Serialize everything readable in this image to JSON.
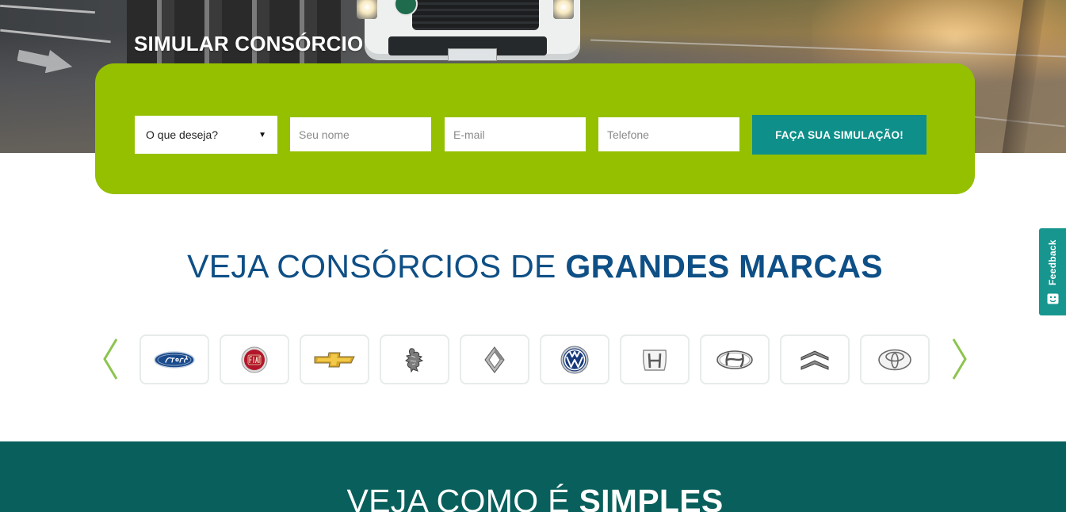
{
  "hero": {
    "title": "SIMULAR CONSÓRCIO"
  },
  "simulation_form": {
    "select": {
      "selected": "O que deseja?"
    },
    "name_field": {
      "placeholder": "Seu nome"
    },
    "email_field": {
      "placeholder": "E-mail"
    },
    "phone_field": {
      "placeholder": "Telefone"
    },
    "submit_label": "FAÇA SUA SIMULAÇÃO!",
    "panel_color": "#94c000",
    "button_color": "#0e8f8a"
  },
  "brands": {
    "title_regular": "VEJA CONSÓRCIOS DE ",
    "title_bold": "GRANDES MARCAS",
    "title_color": "#0e4f86",
    "prev_icon": "chevron-left-icon",
    "next_icon": "chevron-right-icon",
    "arrow_color": "#8cc44e",
    "items": [
      {
        "icon": "ford-logo-icon"
      },
      {
        "icon": "fiat-logo-icon"
      },
      {
        "icon": "chevrolet-logo-icon"
      },
      {
        "icon": "peugeot-logo-icon"
      },
      {
        "icon": "renault-logo-icon"
      },
      {
        "icon": "volkswagen-logo-icon"
      },
      {
        "icon": "honda-logo-icon"
      },
      {
        "icon": "hyundai-logo-icon"
      },
      {
        "icon": "citroen-logo-icon"
      },
      {
        "icon": "toyota-logo-icon"
      }
    ]
  },
  "how_it_works": {
    "title_regular": "VEJA COMO É ",
    "title_bold": "SIMPLES",
    "background": "#085f5b"
  },
  "feedback": {
    "label": "Feedback",
    "icon": "smiley-icon",
    "color": "#17968f"
  }
}
